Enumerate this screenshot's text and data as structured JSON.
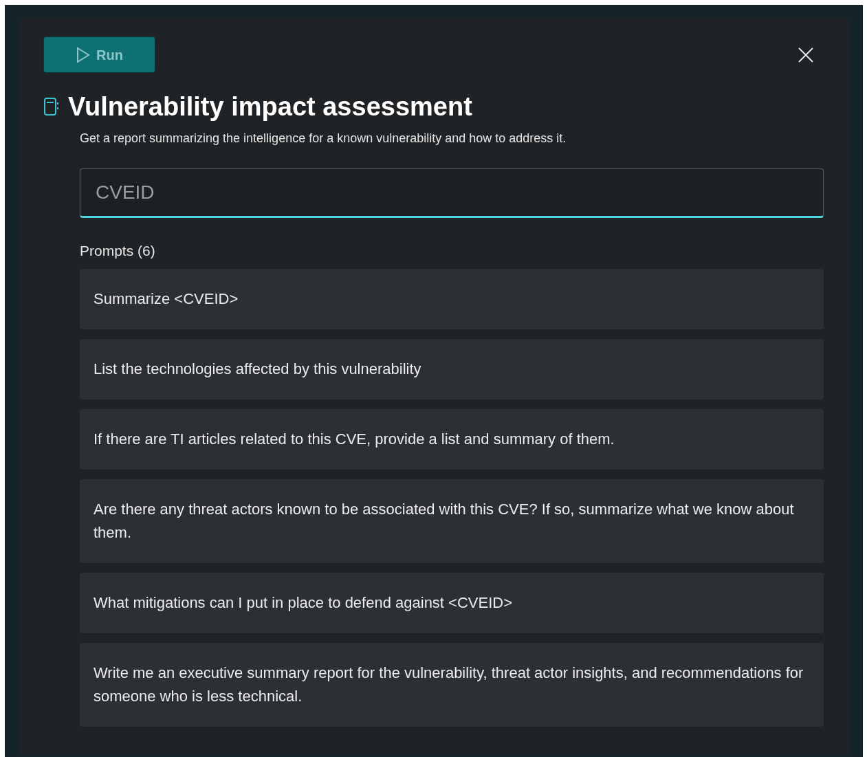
{
  "run_button": {
    "label": "Run",
    "disabled": true
  },
  "title": "Vulnerability impact assessment",
  "description": "Get a report summarizing the intelligence for a known vulnerability and how to address it.",
  "input": {
    "placeholder": "CVEID"
  },
  "prompts_heading": "Prompts (6)",
  "prompts": [
    "Summarize <CVEID>",
    "List the technologies affected by this vulnerability",
    "If there are TI articles related to this CVE, provide a list and summary of them.",
    "Are there any threat actors known to be associated with this CVE? If so, summarize what we know about them.",
    "What mitigations can I put in place to defend against <CVEID>",
    "Write me an executive summary report for the vulnerability, threat actor insights, and recommendations for someone who is less technical."
  ]
}
